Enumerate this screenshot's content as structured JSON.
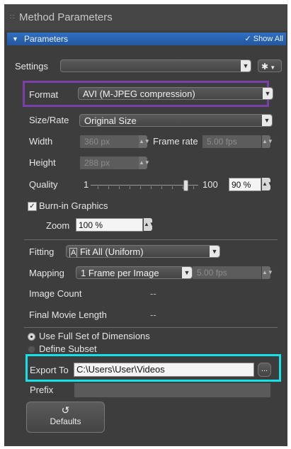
{
  "header": {
    "title": "Method Parameters"
  },
  "section": {
    "title": "Parameters",
    "show_all": "Show All"
  },
  "settings": {
    "label": "Settings",
    "value": ""
  },
  "format": {
    "label": "Format",
    "value": "AVI (M-JPEG compression)"
  },
  "size_rate": {
    "label": "Size/Rate",
    "value": "Original Size"
  },
  "width": {
    "label": "Width",
    "value": "360 px"
  },
  "frame_rate": {
    "label": "Frame rate",
    "value": "5.00 fps"
  },
  "height": {
    "label": "Height",
    "value": "288 px"
  },
  "quality": {
    "label": "Quality",
    "min": "1",
    "max": "100",
    "value": "90 %",
    "level_percent": 90
  },
  "burn_in": {
    "label": "Burn-in Graphics",
    "checked": true
  },
  "zoom": {
    "label": "Zoom",
    "value": "100 %"
  },
  "fitting": {
    "label": "Fitting",
    "value": "Fit All (Uniform)"
  },
  "mapping": {
    "label": "Mapping",
    "value": "1 Frame per Image",
    "fps": "5.00 fps"
  },
  "image_count": {
    "label": "Image Count",
    "value": "--"
  },
  "final_length": {
    "label": "Final Movie Length",
    "value": "--"
  },
  "dimensions": {
    "full": "Use Full Set of Dimensions",
    "subset": "Define Subset"
  },
  "export_to": {
    "label": "Export To",
    "value": "C:\\Users\\User\\Videos",
    "browse": "..."
  },
  "prefix": {
    "label": "Prefix",
    "value": ""
  },
  "defaults": {
    "label": "Defaults"
  }
}
